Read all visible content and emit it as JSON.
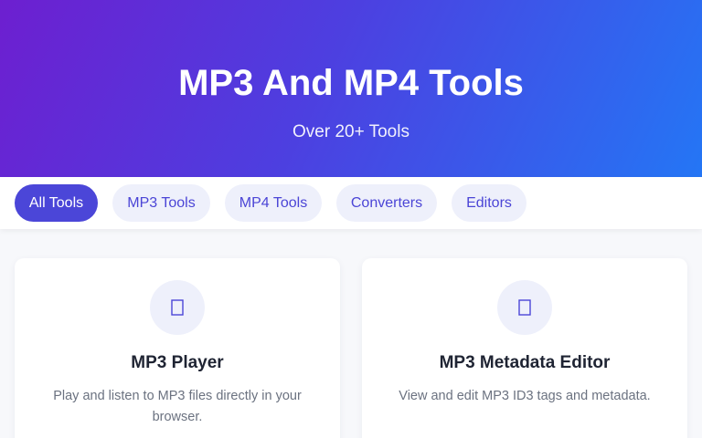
{
  "hero": {
    "title": "MP3 And MP4 Tools",
    "subtitle": "Over 20+ Tools"
  },
  "filters": [
    {
      "label": "All Tools",
      "active": true
    },
    {
      "label": "MP3 Tools",
      "active": false
    },
    {
      "label": "MP4 Tools",
      "active": false
    },
    {
      "label": "Converters",
      "active": false
    },
    {
      "label": "Editors",
      "active": false
    }
  ],
  "tools": [
    {
      "icon": "music-player-icon",
      "title": "MP3 Player",
      "description": "Play and listen to MP3 files directly in your browser."
    },
    {
      "icon": "tag-edit-icon",
      "title": "MP3 Metadata Editor",
      "description": "View and edit MP3 ID3 tags and metadata."
    }
  ],
  "colors": {
    "accent": "#4b46d8",
    "pill_bg": "#eef0fb",
    "hero_start": "#6d1fd0",
    "hero_end": "#2476f5"
  }
}
